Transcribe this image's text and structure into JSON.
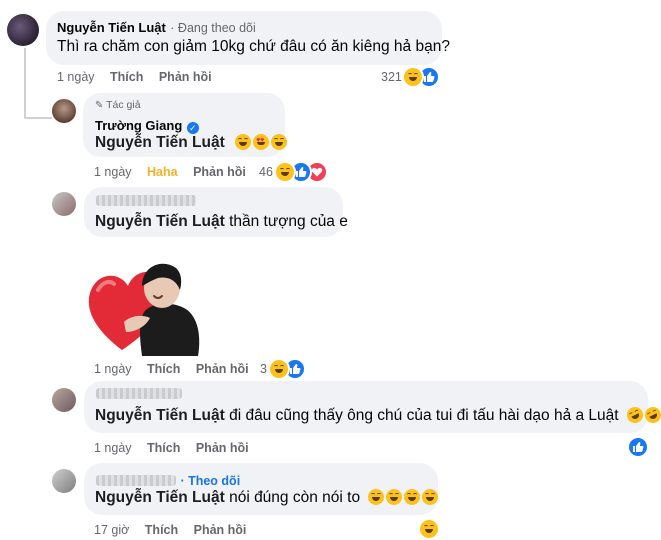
{
  "comments": [
    {
      "author": "Nguyễn Tiến Luật",
      "follow_status": "· Đang theo dõi",
      "text": "Thì ra chăm con giảm 10kg chứ đâu có ăn kiêng hả bạn?",
      "time": "1 ngày",
      "like": "Thích",
      "reply": "Phản hồi",
      "reaction_count": "321"
    },
    {
      "author_badge": "Tác giả",
      "author": "Trường Giang",
      "mention": "Nguyễn Tiến Luật",
      "time": "1 ngày",
      "reacted": "Haha",
      "reply": "Phản hồi",
      "reaction_count": "46"
    },
    {
      "mention": "Nguyễn Tiến Luật",
      "text": " thần tượng của e"
    },
    {
      "time": "1 ngày",
      "like": "Thích",
      "reply": "Phản hồi",
      "reaction_count": "3"
    },
    {
      "mention": "Nguyễn Tiến Luật",
      "text": " đi đâu cũng thấy ông chú của tui đi tấu hài dạo hả a Luật",
      "time": "1 ngày",
      "like": "Thích",
      "reply": "Phản hồi"
    },
    {
      "follow_status": "· Theo dõi",
      "mention": "Nguyễn Tiến Luật",
      "text": " nói đúng còn nói to",
      "time": "17 giờ",
      "like": "Thích",
      "reply": "Phản hồi"
    }
  ],
  "colors": {
    "bubble": "#f0f2f5",
    "like_blue": "#1877f2",
    "haha": "#f7b125",
    "meta_grey": "#65676b"
  }
}
